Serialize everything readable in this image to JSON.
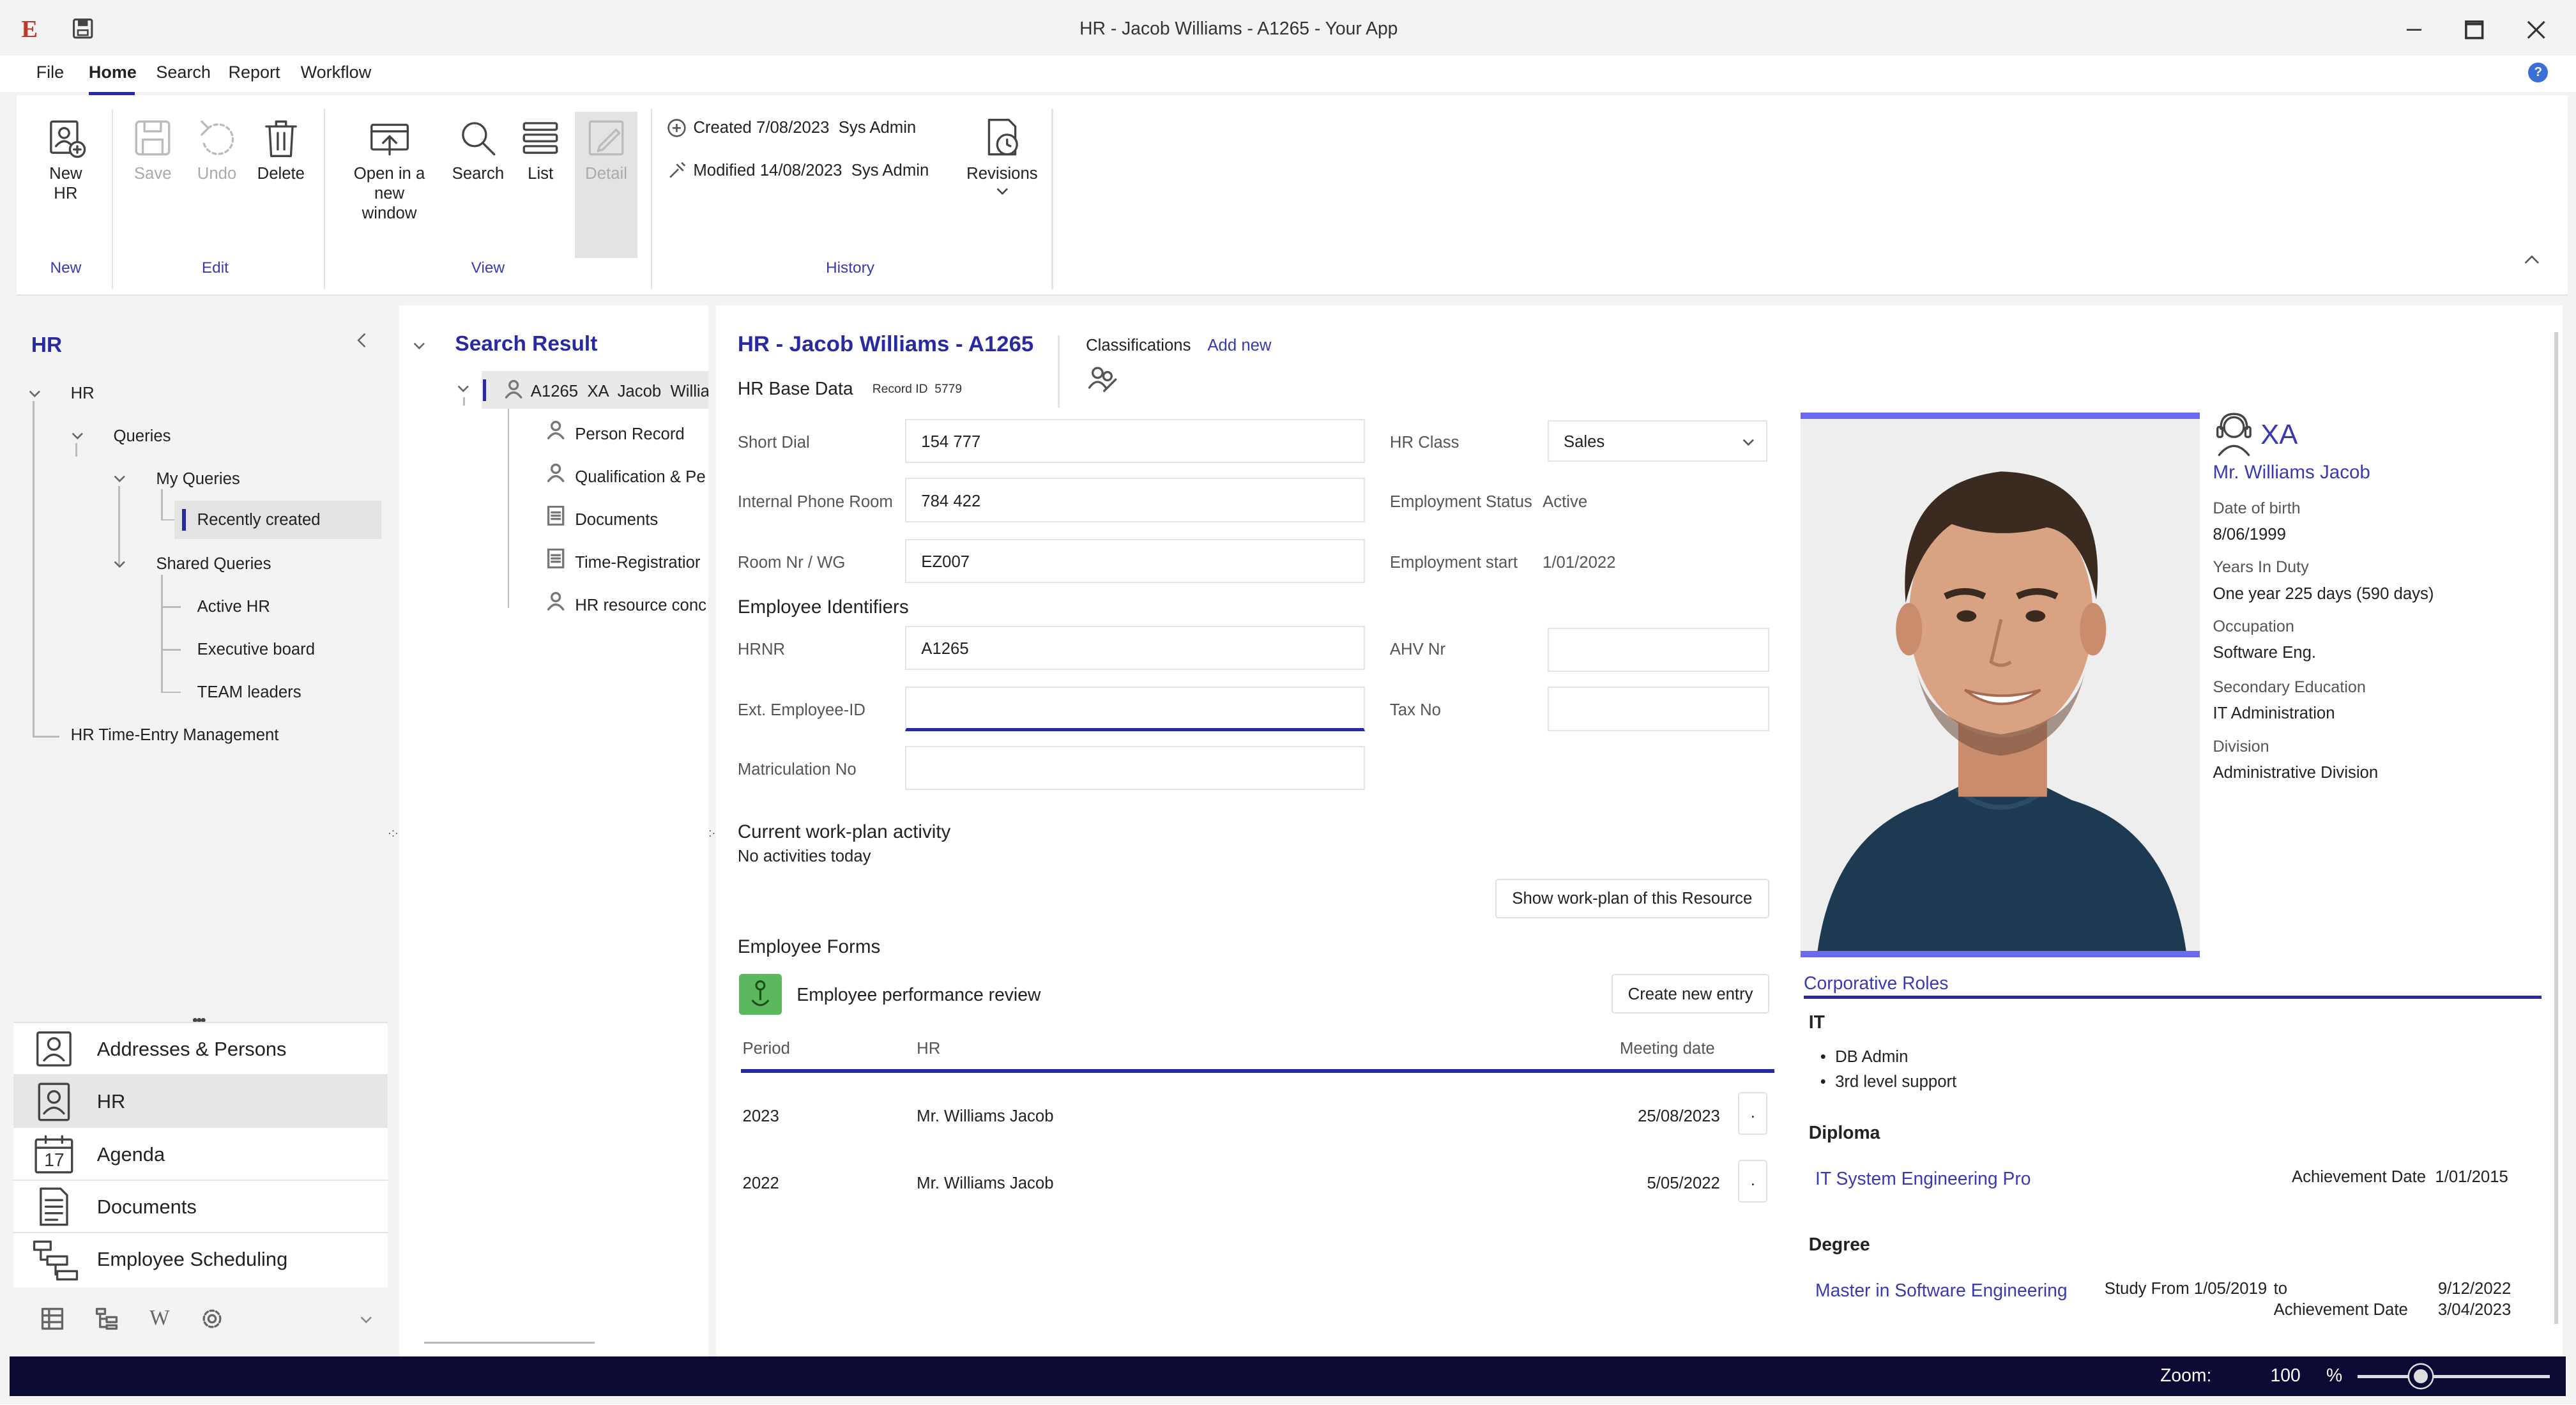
{
  "window": {
    "title": "HR - Jacob Williams - A1265 - Your App"
  },
  "menu": {
    "items": [
      "File",
      "Home",
      "Search",
      "Report",
      "Workflow"
    ],
    "active": "Home"
  },
  "ribbon": {
    "new_hr": "New HR",
    "save": "Save",
    "undo": "Undo",
    "delete": "Delete",
    "open_new_window": "Open in a new window",
    "search": "Search",
    "list": "List",
    "detail": "Detail",
    "created_label": "Created",
    "created_value": "7/08/2023",
    "created_by": "Sys Admin",
    "modified_label": "Modified",
    "modified_value": "14/08/2023",
    "modified_by": "Sys Admin",
    "revisions": "Revisions",
    "groups": {
      "new": "New",
      "edit": "Edit",
      "view": "View",
      "history": "History"
    }
  },
  "left_panel": {
    "title": "HR",
    "tree": {
      "root": "HR",
      "queries": "Queries",
      "my_queries": "My Queries",
      "recently_created": "Recently created",
      "shared_queries": "Shared Queries",
      "active_hr": "Active HR",
      "executive_board": "Executive board",
      "team_leaders": "TEAM leaders",
      "time_entry": "HR Time-Entry Management"
    },
    "nav": [
      "Addresses & Persons",
      "HR",
      "Agenda",
      "Documents",
      "Employee Scheduling"
    ],
    "agenda_day": "17",
    "selected_nav": "HR"
  },
  "search_result": {
    "title": "Search Result",
    "record": "A1265  XA  Jacob  Willia",
    "children": [
      "Person Record",
      "Qualification & Pe",
      "Documents",
      "Time-Registratior",
      "HR resource conc"
    ]
  },
  "record": {
    "heading": "HR - Jacob Williams - A1265",
    "base_data": "HR Base Data",
    "record_id_label": "Record ID",
    "record_id": "5779",
    "classifications": "Classifications",
    "add_new": "Add new",
    "fields": {
      "short_dial_label": "Short Dial",
      "short_dial": "154 777",
      "internal_phone_label": "Internal Phone Room",
      "internal_phone": "784 422",
      "room_label": "Room Nr / WG",
      "room": "EZ007",
      "hr_class_label": "HR Class",
      "hr_class": "Sales",
      "employment_status_label": "Employment Status",
      "employment_status": "Active",
      "employment_start_label": "Employment start",
      "employment_start": "1/01/2022"
    },
    "identifiers_title": "Employee Identifiers",
    "identifiers": {
      "hrnr_label": "HRNR",
      "hrnr": "A1265",
      "ext_id_label": "Ext. Employee-ID",
      "ext_id": "",
      "matric_label": "Matriculation No",
      "matric": "",
      "ahv_label": "AHV Nr",
      "ahv": "",
      "tax_label": "Tax No",
      "tax": ""
    },
    "workplan_title": "Current work-plan activity",
    "workplan_text": "No activities today",
    "show_workplan": "Show work-plan of this Resource",
    "forms_title": "Employee Forms",
    "form_name": "Employee performance review",
    "create_entry": "Create new entry",
    "table_headers": [
      "Period",
      "HR",
      "Meeting date"
    ],
    "table_rows": [
      {
        "period": "2023",
        "hr": "Mr. Williams Jacob",
        "date": "25/08/2023"
      },
      {
        "period": "2022",
        "hr": "Mr. Williams Jacob",
        "date": "5/05/2022"
      }
    ]
  },
  "profile": {
    "code": "XA",
    "name": "Mr. Williams Jacob",
    "dob_label": "Date of birth",
    "dob": "8/06/1999",
    "years_label": "Years In Duty",
    "years": "One year 225 days (590 days)",
    "occupation_label": "Occupation",
    "occupation": "Software Eng.",
    "secondary_label": "Secondary Education",
    "secondary": "IT Administration",
    "division_label": "Division",
    "division": "Administrative Division",
    "roles_title": "Corporative Roles",
    "it_title": "IT",
    "it_roles": [
      "DB Admin",
      "3rd level support"
    ],
    "diploma_title": "Diploma",
    "diploma_name": "IT System Engineering Pro",
    "achievement_label": "Achievement Date",
    "diploma_date": "1/01/2015",
    "degree_title": "Degree",
    "degree_name": "Master in Software Engineering",
    "study_from_label": "Study From",
    "study_from": "1/05/2019",
    "to_label": "to",
    "study_to": "9/12/2022",
    "degree_achievement_label": "Achievement Date",
    "degree_achievement": "3/04/2023"
  },
  "status": {
    "zoom_label": "Zoom:",
    "zoom_value": "100",
    "zoom_unit": "%",
    "zoom_fraction": 0.33
  },
  "colors": {
    "accent": "#2a2aa0",
    "status_bar": "#0a0a35",
    "link": "#3a3ab0",
    "form_icon": "#5cb85c",
    "photo_frame": "#6a6af0"
  }
}
